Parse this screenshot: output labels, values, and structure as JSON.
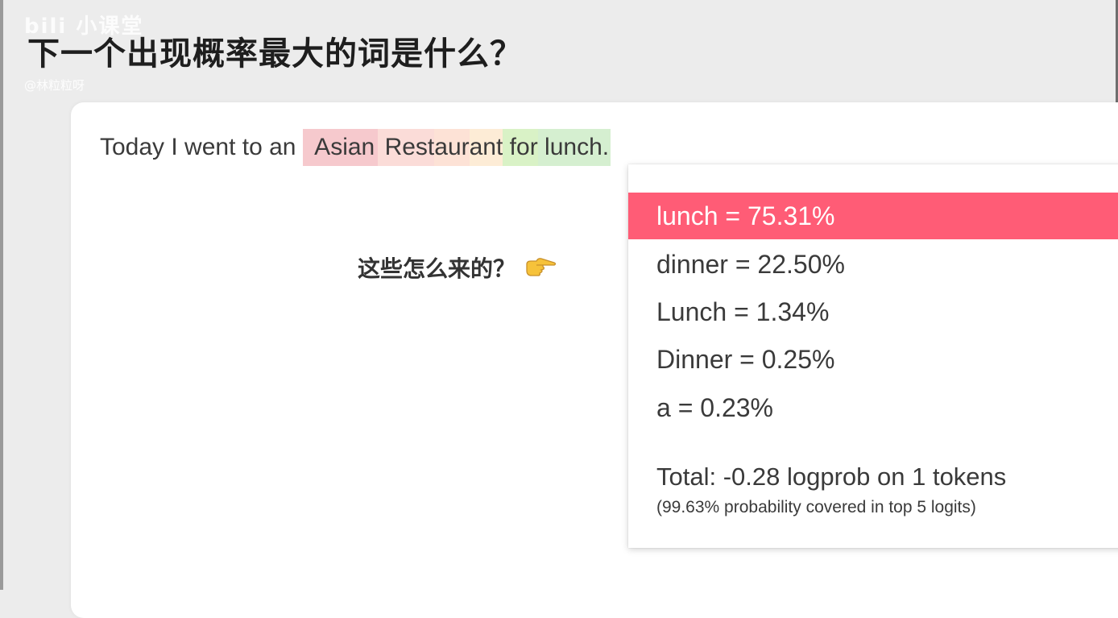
{
  "watermark": {
    "logo": "bili 小课堂",
    "handle": "@林粒粒呀"
  },
  "heading": "下一个出现概率最大的词是什么？",
  "sentence": {
    "prefix": "Today I went to an",
    "tokens": [
      " Asian",
      " Rest",
      "aur",
      "ant",
      " for",
      " lunch."
    ]
  },
  "question": "这些怎么来的？",
  "completions": {
    "options": [
      {
        "label": "lunch = 75.31%"
      },
      {
        "label": "dinner = 22.50%"
      },
      {
        "label": "Lunch = 1.34%"
      },
      {
        "label": "Dinner = 0.25%"
      },
      {
        "label": "a = 0.23%"
      }
    ],
    "selected_index": 0,
    "total": "Total: -0.28 logprob on 1 tokens",
    "coverage": "(99.63% probability covered in top 5 logits)"
  },
  "colors": {
    "selected": "#ff5c76",
    "token_high": "#f6c9cd",
    "token_low": "#d9f2c6",
    "background": "#ececec"
  },
  "icons": [
    "pointing-right-hand-icon"
  ]
}
